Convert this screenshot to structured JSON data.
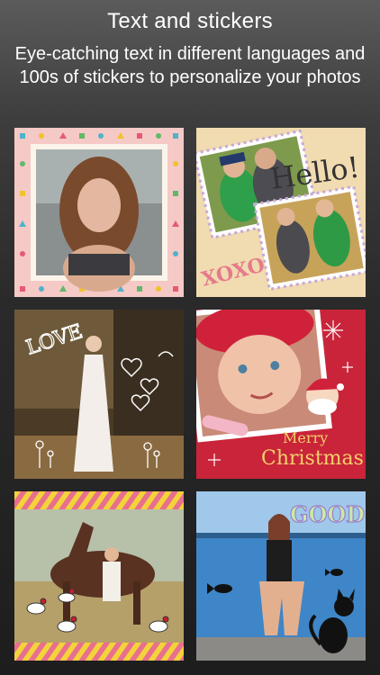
{
  "header": {
    "title": "Text and stickers",
    "subtitle": "Eye-catching text in different languages and 100s of stickers to personalize your photos"
  },
  "samples": {
    "hello": "Hello!",
    "xoxo": "XOXO",
    "love": "LOVE",
    "merry": "Merry",
    "christmas": "Christmas",
    "good": "GOOD"
  },
  "colors": {
    "pink_frame": "#f5c9c6",
    "cream": "#f1dbb0",
    "red_card": "#c9243a",
    "stripe_yellow": "#f3d33a",
    "stripe_pink": "#e86f8e"
  }
}
